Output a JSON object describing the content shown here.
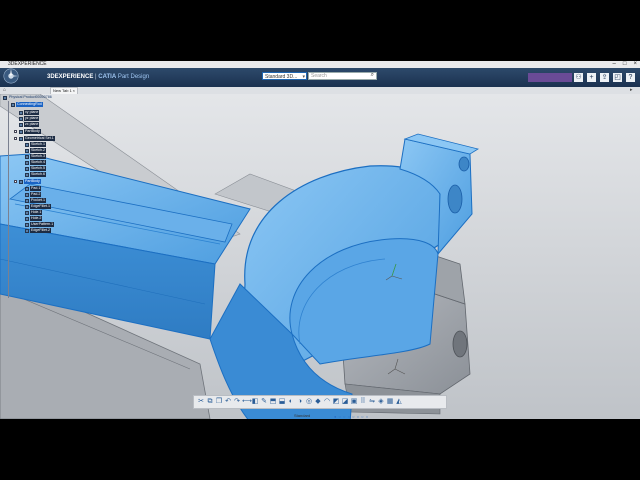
{
  "window": {
    "title": "3DEXPERIENCE",
    "controls": [
      "–",
      "□",
      "×"
    ]
  },
  "topbar": {
    "brand_prefix": "3DEXPERIENCE",
    "separator": " | ",
    "brand_app_bold": "CATIA",
    "brand_app": " Part Design",
    "standard_select": "Standard 3D...",
    "search_placeholder": "Search",
    "user_badge_color": "#6a4b96",
    "icons": [
      "user-icon",
      "add-icon",
      "share-icon",
      "communication-icon",
      "help-icon"
    ]
  },
  "tabs": [
    {
      "label": "New Tab 1",
      "close": "×"
    }
  ],
  "tree": {
    "root": "Physical Product00000786",
    "part": "ConnectingRod",
    "items": [
      {
        "label": "xy plane",
        "level": 1
      },
      {
        "label": "yz plane",
        "level": 1
      },
      {
        "label": "zx plane",
        "level": 1
      },
      {
        "label": "PartBody",
        "level": 1
      },
      {
        "label": "Geometrical Set.1",
        "level": 1
      },
      {
        "label": "Sketch.1",
        "level": 2
      },
      {
        "label": "Sketch.2",
        "level": 2
      },
      {
        "label": "Sketch.3",
        "level": 2
      },
      {
        "label": "Sketch.4",
        "level": 2
      },
      {
        "label": "Sketch.5",
        "level": 2
      },
      {
        "label": "Sketch.6",
        "level": 2
      },
      {
        "label": "PartBody",
        "level": 1,
        "selected": true
      },
      {
        "label": "Pad.1",
        "level": 2
      },
      {
        "label": "Pad.2",
        "level": 2
      },
      {
        "label": "Pocket.1",
        "level": 2
      },
      {
        "label": "EdgeFillet.1",
        "level": 2
      },
      {
        "label": "Hole.1",
        "level": 2
      },
      {
        "label": "Hole.2",
        "level": 2
      },
      {
        "label": "UserPattern.1",
        "level": 2
      },
      {
        "label": "EdgeFillet.2",
        "level": 2
      }
    ]
  },
  "actionbar": {
    "section_label": "Standard",
    "icons": [
      "undo-icon",
      "cut-icon",
      "copy-icon",
      "paste-icon",
      "redo-icon",
      "measure-icon",
      "plane-icon",
      "sketch-icon",
      "pad-icon",
      "pocket-icon",
      "shaft-icon",
      "groove-icon",
      "hole-icon",
      "rib-icon",
      "fillet-icon",
      "chamfer-icon",
      "draft-icon",
      "shell-icon",
      "pattern-icon",
      "mirror-icon",
      "render-icon",
      "view-icon",
      "apply-material-icon"
    ]
  },
  "colors": {
    "part_highlight": "#4b9fe6",
    "part_edge": "#1c6fc2",
    "background": "#cfd2d6",
    "topbar": "#1f3a5c"
  }
}
